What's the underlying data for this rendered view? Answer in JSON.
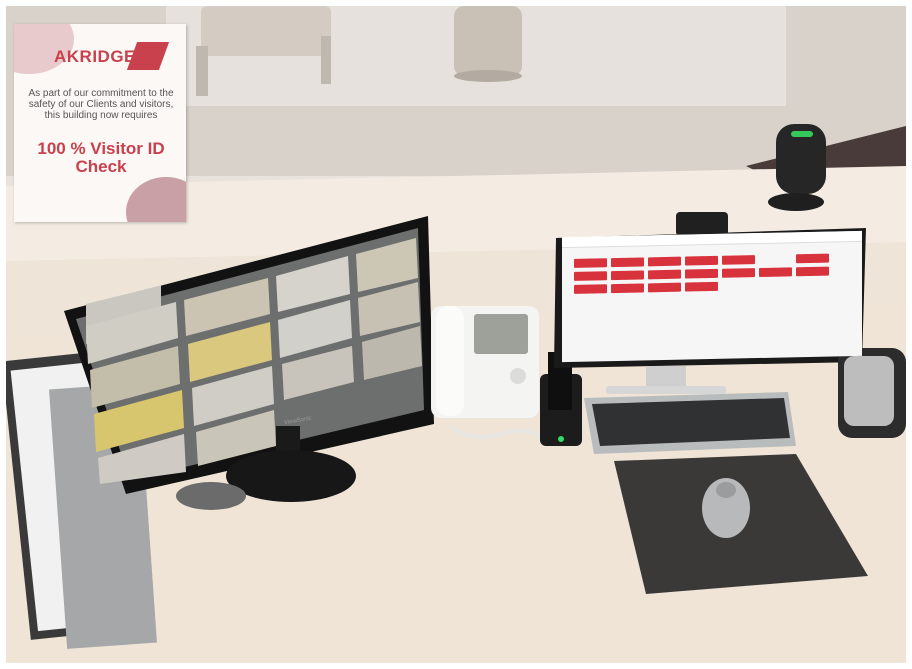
{
  "sign": {
    "brand": "AKRIDGE",
    "message": "As part of our commitment to the safety of our Clients and visitors, this building now requires",
    "headline": "100 % Visitor ID Check"
  },
  "monitor_brand": "ViewSonic",
  "colors": {
    "sign_red": "#c8414c",
    "tile_red": "#d8333d",
    "desk": "#efe6da",
    "mousepad": "#3b3938"
  }
}
